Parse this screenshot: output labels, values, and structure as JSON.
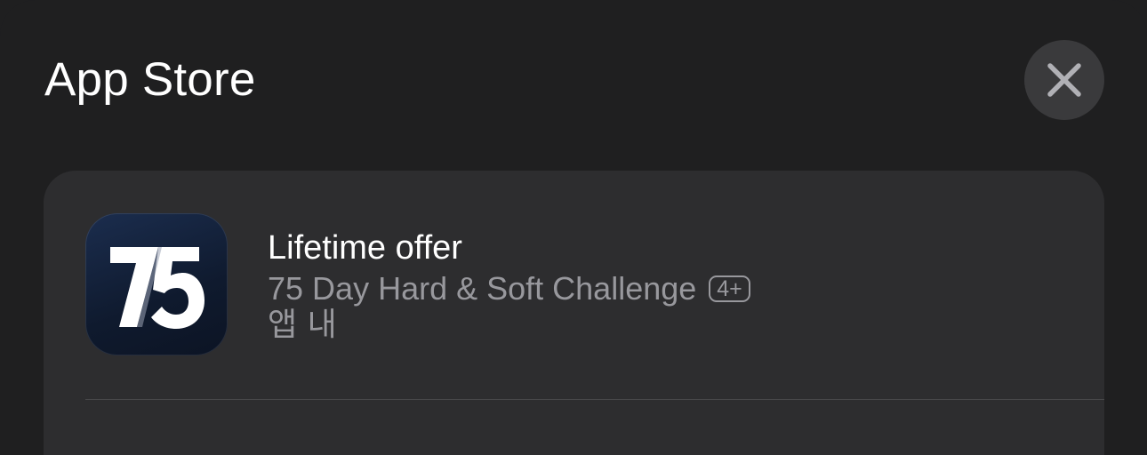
{
  "sheet": {
    "title": "App Store",
    "close_icon": "close-icon"
  },
  "offer": {
    "title": "Lifetime offer",
    "app_name": "75 Day Hard & Soft Challenge",
    "age_rating": "4+",
    "in_app_label": "앱 내",
    "app_icon_text": "75"
  },
  "colors": {
    "background": "#1f1f20",
    "card": "#2d2d2f",
    "close_button": "#3a3a3c",
    "secondary_text": "#98989d",
    "app_icon_bg": "#14223c"
  }
}
